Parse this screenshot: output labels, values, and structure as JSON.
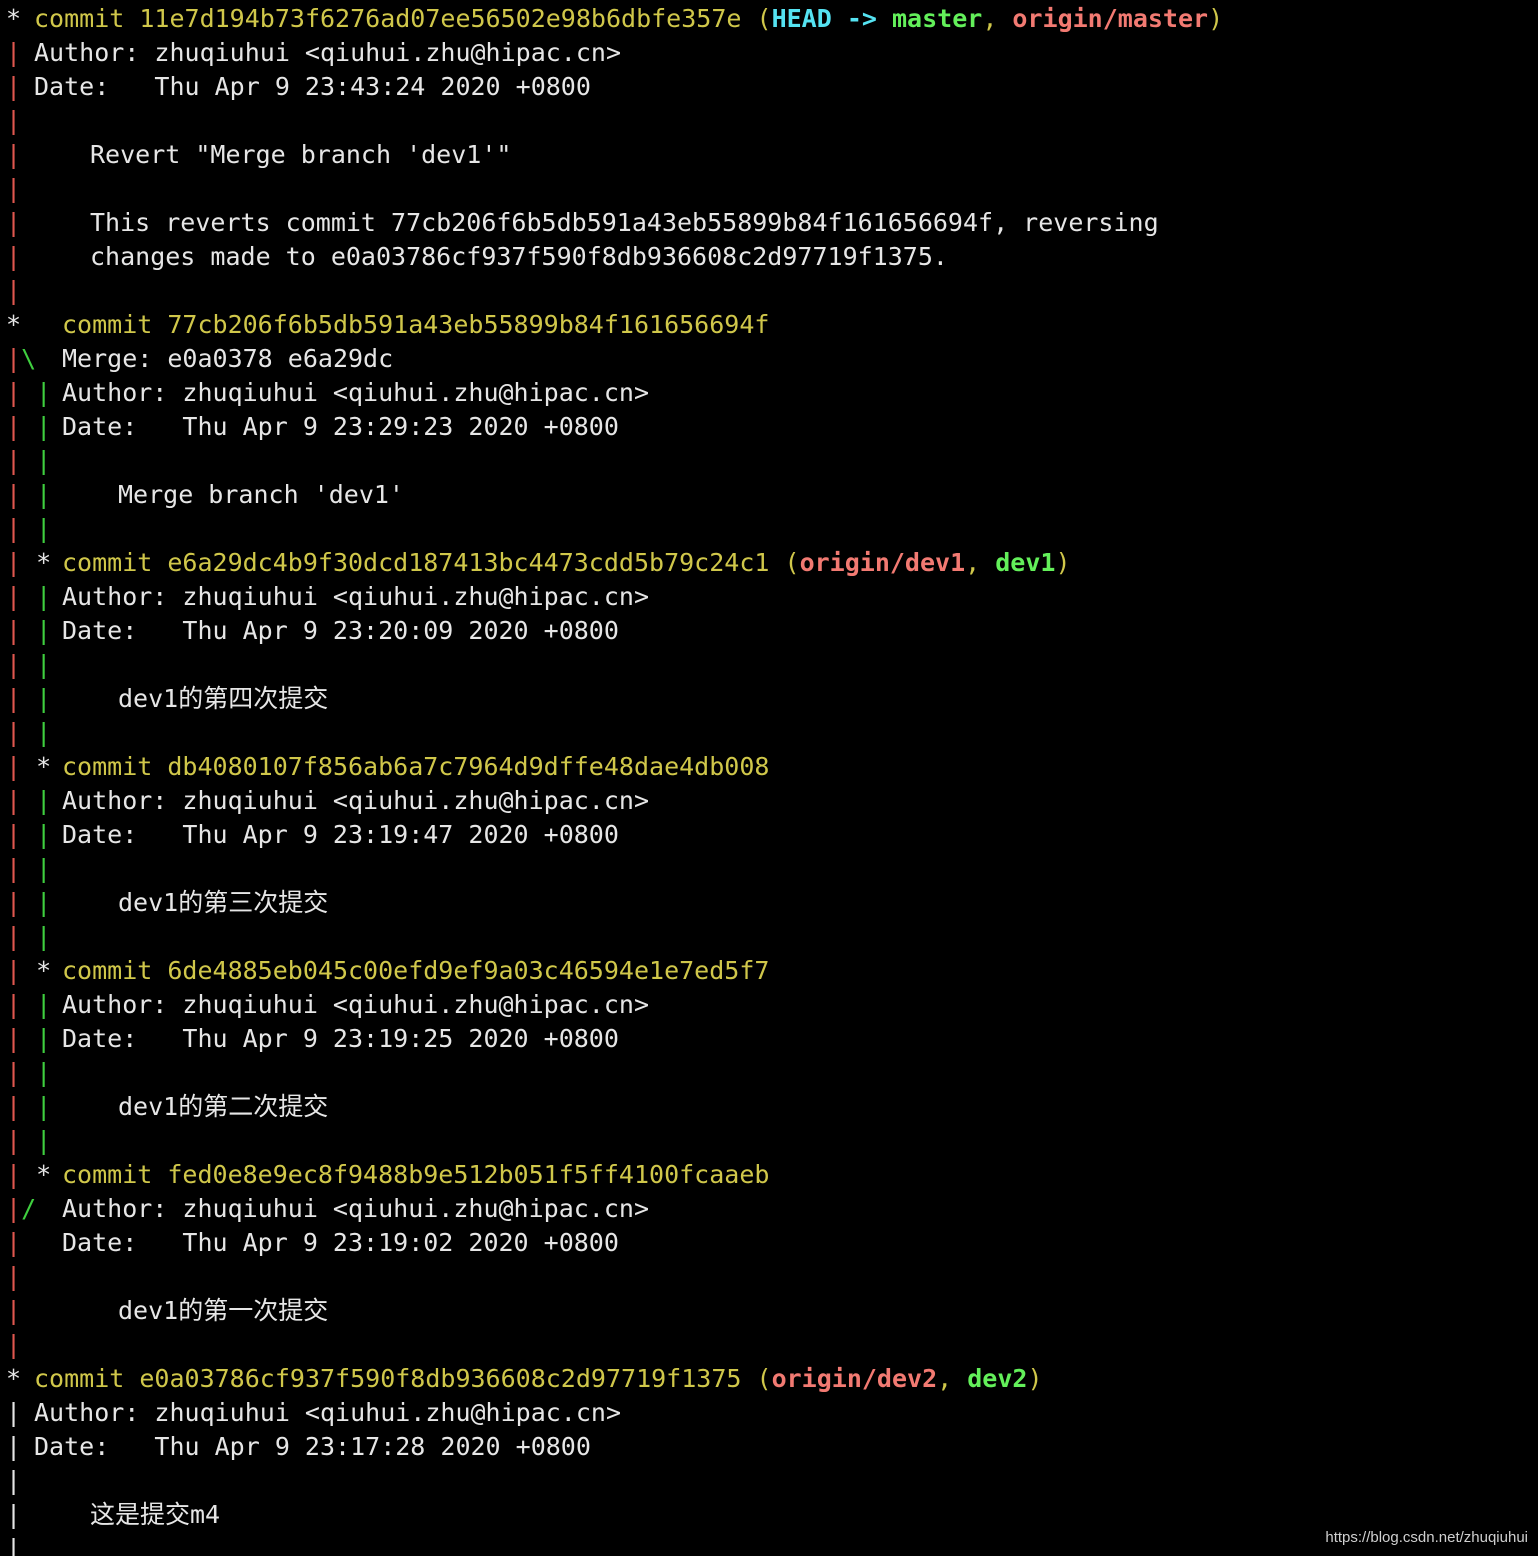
{
  "colors": {
    "background": "#000000",
    "text": "#e6e6e6",
    "graph_master": "#e0574f",
    "graph_branch": "#3fcf3f",
    "commit_hash": "#d0c74a",
    "head_ref": "#55e3f2",
    "local_branch": "#63f05a",
    "remote_branch": "#f27a72"
  },
  "text": {
    "commit": "commit",
    "author_label": "Author:",
    "date_label": "Date:",
    "merge_label": "Merge:",
    "open_paren": "(",
    "close_paren": ")",
    "comma": ", ",
    "arrow": " -> ",
    "author_value": "zhuqiuhui <qiuhui.zhu@hipac.cn>"
  },
  "commits": [
    {
      "hash": "11e7d194b73f6276ad07ee56502e98b6dbfe357e",
      "head": "HEAD",
      "local_ref": "master",
      "remote_ref": "origin/master",
      "date": "Thu Apr 9 23:43:24 2020 +0800",
      "message_1": "Revert \"Merge branch 'dev1'\"",
      "message_2": "This reverts commit 77cb206f6b5db591a43eb55899b84f161656694f, reversing",
      "message_3": "changes made to e0a03786cf937f590f8db936608c2d97719f1375."
    },
    {
      "hash": "77cb206f6b5db591a43eb55899b84f161656694f",
      "merge": "e0a0378 e6a29dc",
      "date": "Thu Apr 9 23:29:23 2020 +0800",
      "message_1": "Merge branch 'dev1'"
    },
    {
      "hash": "e6a29dc4b9f30dcd187413bc4473cdd5b79c24c1",
      "remote_ref": "origin/dev1",
      "local_ref": "dev1",
      "date": "Thu Apr 9 23:20:09 2020 +0800",
      "message_1": "dev1的第四次提交"
    },
    {
      "hash": "db4080107f856ab6a7c7964d9dffe48dae4db008",
      "date": "Thu Apr 9 23:19:47 2020 +0800",
      "message_1": "dev1的第三次提交"
    },
    {
      "hash": "6de4885eb045c00efd9ef9a03c46594e1e7ed5f7",
      "date": "Thu Apr 9 23:19:25 2020 +0800",
      "message_1": "dev1的第二次提交"
    },
    {
      "hash": "fed0e8e9ec8f9488b9e512b051f5ff4100fcaaeb",
      "date": "Thu Apr 9 23:19:02 2020 +0800",
      "message_1": "dev1的第一次提交"
    },
    {
      "hash": "e0a03786cf937f590f8db936608c2d97719f1375",
      "remote_ref": "origin/dev2",
      "local_ref": "dev2",
      "date": "Thu Apr 9 23:17:28 2020 +0800",
      "message_1": "这是提交m4"
    }
  ],
  "graph": {
    "star": "*",
    "bar": "|",
    "merge_open": "|\\",
    "merge_close": "|/",
    "bar_bar": "| |",
    "bar_star": "| *"
  },
  "watermark": "https://blog.csdn.net/zhuqiuhui"
}
